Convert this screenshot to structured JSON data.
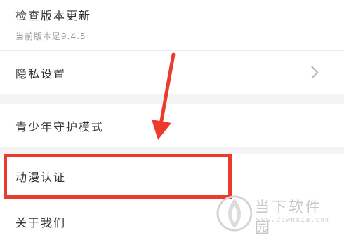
{
  "settings": {
    "check_update": {
      "label": "检查版本更新",
      "version_text": "当前版本是9.4.5"
    },
    "privacy": {
      "label": "隐私设置"
    },
    "youth_mode": {
      "label": "青少年守护模式"
    },
    "anime_auth": {
      "label": "动漫认证"
    },
    "about": {
      "label": "关于我们"
    }
  },
  "annotation": {
    "arrow_color": "#ec3b2c",
    "box_color": "#ec3b2c"
  },
  "watermark": {
    "title": "当下软件园",
    "url": "www.downxia.com"
  }
}
